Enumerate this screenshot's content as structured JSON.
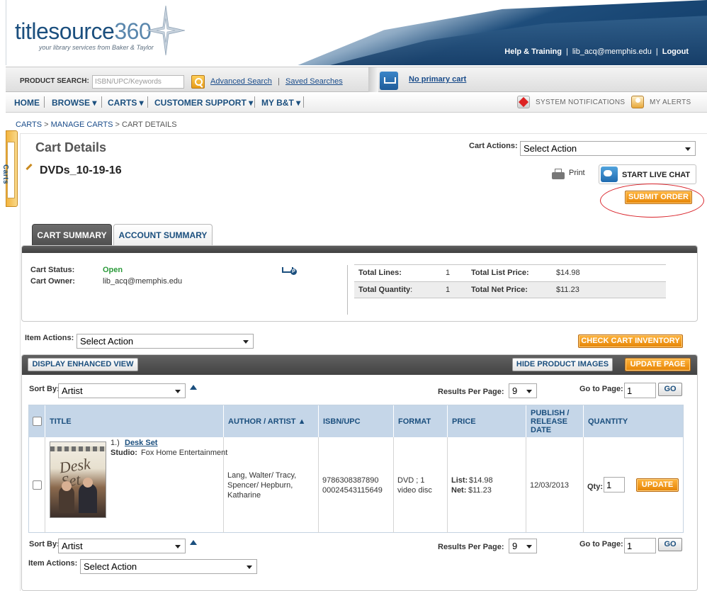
{
  "header": {
    "logo": "titlesource",
    "logo_num": "360",
    "tagline": "your library services from Baker & Taylor",
    "help_label": "Help & Training",
    "user_email": "lib_acq@memphis.edu",
    "logout_label": "Logout"
  },
  "search": {
    "label": "PRODUCT SEARCH:",
    "placeholder": "ISBN/UPC/Keywords",
    "advanced_label": "Advanced Search",
    "saved_label": "Saved Searches",
    "primary_cart_label": "No primary cart"
  },
  "nav": {
    "home": "HOME",
    "browse": "BROWSE ▾",
    "carts": "CARTS ▾",
    "support": "CUSTOMER SUPPORT ▾",
    "mybt": "MY B&T ▾",
    "system_notifications": "SYSTEM NOTIFICATIONS",
    "my_alerts": "MY ALERTS"
  },
  "breadcrumb": {
    "carts": "CARTS",
    "manage": "MANAGE CARTS",
    "current": "CART DETAILS",
    "sep": " > "
  },
  "side_tab": {
    "label": "Carts"
  },
  "page": {
    "title": "Cart Details",
    "cart_actions_label": "Cart Actions:",
    "cart_actions_value": "Select Action",
    "cart_name": "DVDs_10-19-16",
    "print_label": "Print",
    "live_chat_label": "START LIVE CHAT",
    "submit_order_label": "SUBMIT ORDER"
  },
  "tabs": {
    "cart_summary": "CART SUMMARY",
    "account_summary": "ACCOUNT SUMMARY"
  },
  "summary": {
    "status_label": "Cart Status:",
    "status_value": "Open",
    "owner_label": "Cart Owner:",
    "owner_value": "lib_acq@memphis.edu",
    "total_lines_label": "Total Lines:",
    "total_lines_value": "1",
    "total_list_price_label": "Total List Price:",
    "total_list_price_value": "$14.98",
    "total_quantity_label": "Total Quantity",
    "total_quantity_colon": ":",
    "total_quantity_value": "1",
    "total_net_price_label": "Total Net Price:",
    "total_net_price_value": "$11.23"
  },
  "items": {
    "item_actions_label": "Item Actions:",
    "item_actions_value": "Select Action",
    "check_inventory_label": "CHECK CART INVENTORY",
    "display_enhanced_label": "DISPLAY ENHANCED VIEW",
    "hide_images_label": "HIDE PRODUCT IMAGES",
    "update_page_label": "UPDATE PAGE",
    "sort_by_label": "Sort By:",
    "sort_by_value": "Artist",
    "results_per_page_label": "Results Per Page:",
    "results_per_page_value": "9",
    "go_to_page_label": "Go to Page:",
    "go_to_page_value": "1",
    "go_label": "GO"
  },
  "table": {
    "headers": {
      "title": "TITLE",
      "author": "AUTHOR / ARTIST ▲",
      "isbn": "ISBN/UPC",
      "format": "FORMAT",
      "price": "PRICE",
      "publish": "PUBLISH / RELEASE DATE",
      "quantity": "QUANTITY"
    },
    "rows": [
      {
        "num": "1.)",
        "title": "Desk Set",
        "studio_label": "Studio:",
        "studio": "Fox Home Entertainment",
        "author": "Lang, Walter/ Tracy, Spencer/ Hepburn, Katharine",
        "isbn1": "9786308387890",
        "isbn2": "00024543115649",
        "format": "DVD ; 1 video disc",
        "list_label": "List:",
        "list_price": "$14.98",
        "net_label": "Net:",
        "net_price": "$11.23",
        "release_date": "12/03/2013",
        "qty_label": "Qty:",
        "qty_value": "1",
        "update_label": "UPDATE",
        "cover_title": "Desk Set"
      }
    ]
  },
  "footer_controls": {
    "sort_by_label": "Sort By:",
    "sort_by_value": "Artist",
    "results_per_page_label": "Results Per Page:",
    "results_per_page_value": "9",
    "go_to_page_label": "Go to Page:",
    "go_to_page_value": "1",
    "go_label": "GO",
    "item_actions_label": "Item Actions:",
    "item_actions_value": "Select Action"
  },
  "colors": {
    "brand_blue": "#1b4f7e",
    "orange_button": "#e58406",
    "status_green": "#2b9a3a",
    "annotation_red": "#d9232a"
  }
}
